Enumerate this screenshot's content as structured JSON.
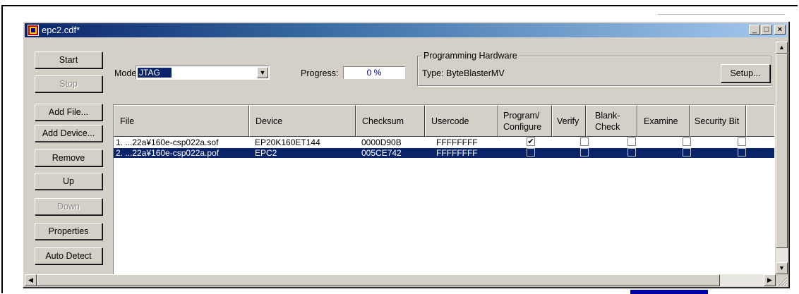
{
  "window": {
    "title": "epc2.cdf*",
    "min_glyph": "_",
    "max_glyph": "□",
    "close_glyph": "×"
  },
  "buttons": {
    "start": "Start",
    "stop": "Stop",
    "add_file": "Add File...",
    "add_device": "Add Device...",
    "remove": "Remove",
    "up": "Up",
    "down": "Down",
    "properties": "Properties",
    "auto_detect": "Auto Detect",
    "setup": "Setup..."
  },
  "mode": {
    "label": "Mode:",
    "value": "JTAG"
  },
  "progress": {
    "label": "Progress:",
    "value": "0 %"
  },
  "hardware": {
    "group_title": "Programming Hardware",
    "type_label": "Type:",
    "type_value": "ByteBlasterMV"
  },
  "columns": {
    "file": "File",
    "device": "Device",
    "checksum": "Checksum",
    "usercode": "Usercode",
    "program_configure": "Program/ Configure",
    "verify": "Verify",
    "blank_check": "Blank- Check",
    "examine": "Examine",
    "security_bit": "Security Bit"
  },
  "rows": [
    {
      "file": "1. ...22a¥160e-csp022a.sof",
      "device": "EP20K160ET144",
      "checksum": "0000D90B",
      "usercode": "FFFFFFFF",
      "program": true,
      "verify": false,
      "blank_check": false,
      "examine": false,
      "security": false,
      "selected": false
    },
    {
      "file": "2. ...22a¥160e-csp022a.pof",
      "device": "EPC2",
      "checksum": "005CE742",
      "usercode": "FFFFFFFF",
      "program": false,
      "verify": false,
      "blank_check": false,
      "examine": false,
      "security": false,
      "selected": true
    }
  ],
  "colors": {
    "titlebar": "#0a246a",
    "face": "#d4d0c8",
    "selection": "#0a246a"
  }
}
